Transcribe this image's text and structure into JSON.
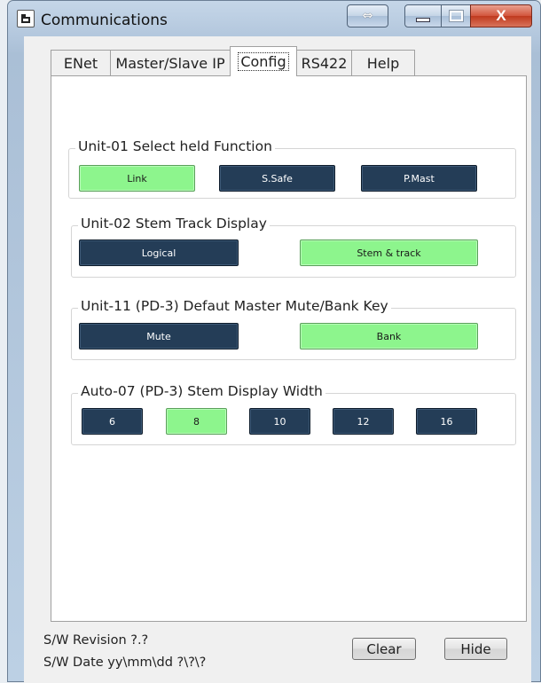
{
  "window": {
    "title": "Communications",
    "controls": {
      "resize_glyph": "⇔",
      "close_glyph": "X"
    }
  },
  "tabs": [
    {
      "label": "ENet",
      "active": false
    },
    {
      "label": "Master/Slave IP",
      "active": false
    },
    {
      "label": "Config",
      "active": true
    },
    {
      "label": "RS422",
      "active": false
    },
    {
      "label": "Help",
      "active": false
    }
  ],
  "config": {
    "groups": [
      {
        "title": "Unit-01 Select held Function",
        "options": [
          {
            "label": "Link",
            "selected": true
          },
          {
            "label": "S.Safe",
            "selected": false
          },
          {
            "label": "P.Mast",
            "selected": false
          }
        ]
      },
      {
        "title": "Unit-02 Stem  Track Display",
        "options": [
          {
            "label": "Logical",
            "selected": false
          },
          {
            "label": "Stem & track",
            "selected": true
          }
        ]
      },
      {
        "title": "Unit-11 (PD-3) Defaut Master Mute/Bank Key",
        "options": [
          {
            "label": "Mute",
            "selected": false
          },
          {
            "label": "Bank",
            "selected": true
          }
        ]
      },
      {
        "title": "Auto-07 (PD-3) Stem Display Width",
        "options": [
          {
            "label": "6",
            "selected": false
          },
          {
            "label": "8",
            "selected": true
          },
          {
            "label": "10",
            "selected": false
          },
          {
            "label": "12",
            "selected": false
          },
          {
            "label": "16",
            "selected": false
          }
        ]
      }
    ]
  },
  "footer": {
    "sw_revision": "S/W Revision   ?.?",
    "sw_date": "S/W Date yy\\mm\\dd  ?\\?\\?",
    "clear_label": "Clear",
    "hide_label": "Hide"
  },
  "colors": {
    "selected": "#8df58d",
    "unselected": "#243d57"
  }
}
